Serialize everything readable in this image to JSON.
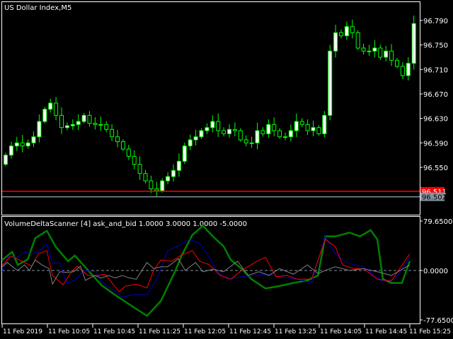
{
  "window": {
    "title": "US Dollar Index,M5"
  },
  "indicator": {
    "title": "VolumeDeltaScanner [4] ask_and_bid 1.0000 3.0000 1.0000 -5.0000"
  },
  "colors": {
    "background": "#000000",
    "frame": "#ffffff",
    "candle": "#00ff00",
    "bull_fill": "#ffffff",
    "bear_fill": "#000000",
    "ask_line": "#ff0000",
    "bid_line": "#8592a0",
    "zero_line": "#8592a0",
    "green": "#008000",
    "blue": "#0000c0",
    "red": "#ff0000",
    "gray": "#808080"
  },
  "chart_data": [
    {
      "type": "candlestick",
      "title": "US Dollar Index,M5",
      "y_ticks": [
        "96.790",
        "96.750",
        "96.710",
        "96.670",
        "96.630",
        "96.590",
        "96.550"
      ],
      "ylim": [
        96.475,
        96.825
      ],
      "first_open": 96.555,
      "close": [
        96.57,
        96.585,
        96.59,
        96.585,
        96.59,
        96.6,
        96.625,
        96.645,
        96.655,
        96.635,
        96.615,
        96.618,
        96.62,
        96.625,
        96.635,
        96.622,
        96.62,
        96.62,
        96.612,
        96.6,
        96.592,
        96.58,
        96.568,
        96.555,
        96.54,
        96.528,
        96.515,
        96.512,
        96.528,
        96.535,
        96.545,
        96.56,
        96.585,
        96.595,
        96.6,
        96.61,
        96.615,
        96.625,
        96.61,
        96.605,
        96.612,
        96.61,
        96.595,
        96.59,
        96.59,
        96.61,
        96.605,
        96.62,
        96.61,
        96.6,
        96.6,
        96.61,
        96.625,
        96.62,
        96.61,
        96.615,
        96.605,
        96.635,
        96.74,
        96.77,
        96.765,
        96.78,
        96.77,
        96.745,
        96.74,
        96.74,
        96.745,
        96.73,
        96.74,
        96.725,
        96.715,
        96.7,
        96.72,
        96.785
      ],
      "ask_price": {
        "value": 96.511,
        "label": "96.511"
      },
      "bid_price": {
        "value": 96.502,
        "label": "96.502"
      }
    },
    {
      "type": "line",
      "title": "VolumeDeltaScanner [4] ask_and_bid 1.0000 3.0000 1.0000 -5.0000",
      "ylim": [
        -77.65,
        79.65
      ],
      "y_ticks": [
        "79.6500",
        "0.0000",
        "-77.6500"
      ],
      "x_ticks": [
        "11 Feb 2019",
        "11 Feb 10:05",
        "11 Feb 10:45",
        "11 Feb 11:25",
        "11 Feb 12:05",
        "11 Feb 12:45",
        "11 Feb 13:25",
        "11 Feb 14:05",
        "11 Feb 14:45",
        "11 Feb 15:25"
      ],
      "series": [
        {
          "name": "green",
          "points": [
            [
              0,
              17
            ],
            [
              1.8,
              30
            ],
            [
              2.8,
              9
            ],
            [
              4.6,
              18
            ],
            [
              5.9,
              52
            ],
            [
              8,
              64
            ],
            [
              9.6,
              38
            ],
            [
              11.8,
              15
            ],
            [
              13,
              24
            ],
            [
              15.3,
              1
            ],
            [
              17.8,
              -24
            ],
            [
              20.3,
              -40
            ],
            [
              24,
              -62
            ],
            [
              25.9,
              -73
            ],
            [
              28.4,
              -49
            ],
            [
              30.9,
              -2
            ],
            [
              32.1,
              24
            ],
            [
              34,
              57
            ],
            [
              35.9,
              72
            ],
            [
              37.8,
              54
            ],
            [
              39.6,
              39
            ],
            [
              40.9,
              17
            ],
            [
              42.8,
              3
            ],
            [
              44.6,
              -14
            ],
            [
              47.1,
              -29
            ],
            [
              49.6,
              -25
            ],
            [
              52.1,
              -20
            ],
            [
              54.6,
              -16
            ],
            [
              56.5,
              -8
            ],
            [
              57.8,
              55
            ],
            [
              59.6,
              55
            ],
            [
              62.1,
              61
            ],
            [
              64,
              55
            ],
            [
              65.9,
              65
            ],
            [
              67.1,
              50
            ],
            [
              68.1,
              -14
            ],
            [
              69.6,
              -20
            ],
            [
              71.5,
              -20
            ],
            [
              72.9,
              15
            ]
          ]
        },
        {
          "name": "blue",
          "points": [
            [
              0,
              -2
            ],
            [
              1.1,
              23
            ],
            [
              2.8,
              21
            ],
            [
              4,
              30
            ],
            [
              5.3,
              27
            ],
            [
              6.5,
              30
            ],
            [
              8,
              43
            ],
            [
              9,
              12
            ],
            [
              10.3,
              12
            ],
            [
              11.5,
              -20
            ],
            [
              13,
              -16
            ],
            [
              14.6,
              0
            ],
            [
              16.9,
              -2
            ],
            [
              17.8,
              -20
            ],
            [
              19,
              -25
            ],
            [
              21.5,
              -43
            ],
            [
              23.4,
              -39
            ],
            [
              25.9,
              -39
            ],
            [
              27.8,
              -12
            ],
            [
              29.6,
              32
            ],
            [
              31.5,
              40
            ],
            [
              33.4,
              50
            ],
            [
              35.3,
              44
            ],
            [
              37.1,
              21
            ],
            [
              38.4,
              -2
            ],
            [
              40.3,
              -14
            ],
            [
              42.8,
              -10
            ],
            [
              47.1,
              -6
            ],
            [
              49.6,
              -10
            ],
            [
              52.8,
              -14
            ],
            [
              55.3,
              -20
            ],
            [
              57.8,
              55
            ],
            [
              59.6,
              27
            ],
            [
              61.5,
              13
            ],
            [
              64.6,
              6
            ],
            [
              67.8,
              -17
            ],
            [
              70.3,
              -14
            ],
            [
              72.9,
              21
            ]
          ]
        },
        {
          "name": "red",
          "points": [
            [
              0,
              8
            ],
            [
              1.5,
              23
            ],
            [
              2.1,
              21
            ],
            [
              4,
              13
            ],
            [
              5.3,
              7
            ],
            [
              6.5,
              27
            ],
            [
              8,
              32
            ],
            [
              9,
              -8
            ],
            [
              10.9,
              -23
            ],
            [
              12.1,
              -6
            ],
            [
              13.4,
              7
            ],
            [
              15.3,
              -8
            ],
            [
              17.1,
              -8
            ],
            [
              18.4,
              -6
            ],
            [
              20.9,
              -34
            ],
            [
              22.1,
              -25
            ],
            [
              24,
              -22
            ],
            [
              25.9,
              -28
            ],
            [
              27.1,
              0
            ],
            [
              28.4,
              17
            ],
            [
              30.3,
              15
            ],
            [
              32.1,
              25
            ],
            [
              34,
              32
            ],
            [
              35.3,
              15
            ],
            [
              37.1,
              9
            ],
            [
              39,
              -8
            ],
            [
              40.9,
              -14
            ],
            [
              42.8,
              0
            ],
            [
              46,
              17
            ],
            [
              47.1,
              21
            ],
            [
              49,
              -10
            ],
            [
              50.9,
              -8
            ],
            [
              52.8,
              -14
            ],
            [
              55.3,
              -14
            ],
            [
              57.8,
              50
            ],
            [
              59.6,
              38
            ],
            [
              60.9,
              9
            ],
            [
              62.8,
              3
            ],
            [
              64.6,
              3
            ],
            [
              67.1,
              -14
            ],
            [
              69.6,
              -17
            ],
            [
              72.9,
              27
            ]
          ]
        },
        {
          "name": "gray",
          "points": [
            [
              0,
              6
            ],
            [
              0.9,
              13
            ],
            [
              2.75,
              0
            ],
            [
              4,
              9
            ],
            [
              4.9,
              0
            ],
            [
              5.9,
              17
            ],
            [
              7.1,
              9
            ],
            [
              8.4,
              3
            ],
            [
              9,
              -22
            ],
            [
              10.3,
              -2
            ],
            [
              11.5,
              -3
            ],
            [
              12.8,
              -2
            ],
            [
              14,
              7
            ],
            [
              14.9,
              -16
            ],
            [
              16.5,
              -8
            ],
            [
              17.75,
              -12
            ],
            [
              19,
              -8
            ],
            [
              20.25,
              -12
            ],
            [
              21.5,
              -8
            ],
            [
              22.75,
              -12
            ],
            [
              24,
              -14
            ],
            [
              25.9,
              13
            ],
            [
              27.1,
              3
            ],
            [
              28.4,
              6
            ],
            [
              29.6,
              6
            ],
            [
              31.5,
              19
            ],
            [
              32.75,
              0
            ],
            [
              34.6,
              13
            ],
            [
              35.9,
              -2
            ],
            [
              37.75,
              2
            ],
            [
              39.6,
              -2
            ],
            [
              42.1,
              15
            ],
            [
              44,
              -8
            ],
            [
              45.9,
              -2
            ],
            [
              47.75,
              -8
            ],
            [
              49.6,
              3
            ],
            [
              52.1,
              -6
            ],
            [
              54.6,
              9
            ],
            [
              56.5,
              -5
            ],
            [
              57.75,
              0
            ],
            [
              59.6,
              6
            ],
            [
              62.1,
              0
            ],
            [
              64.6,
              3
            ],
            [
              67.1,
              -2
            ],
            [
              69.6,
              -8
            ],
            [
              72.9,
              9
            ]
          ]
        }
      ]
    }
  ]
}
